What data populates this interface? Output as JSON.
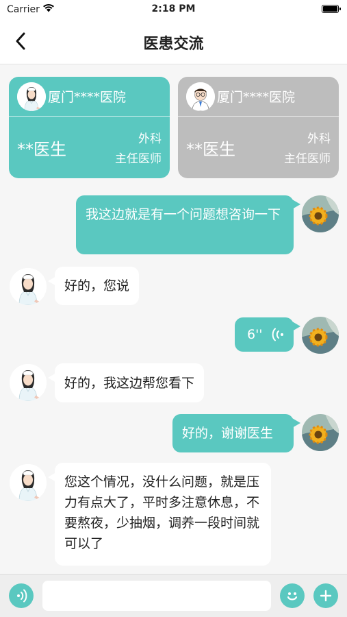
{
  "status_bar": {
    "carrier": "Carrier",
    "time": "2:18 PM"
  },
  "nav": {
    "title": "医患交流"
  },
  "doctor_cards": [
    {
      "hospital": "厦门****医院",
      "name": "**医生",
      "department": "外科",
      "rank": "主任医师"
    },
    {
      "hospital": "厦门****医院",
      "name": "**医生",
      "department": "外科",
      "rank": "主任医师"
    }
  ],
  "messages": [
    {
      "from": "me",
      "text": "我这边就是有一个问题想咨询一下"
    },
    {
      "from": "doctor",
      "text": "好的，您说"
    },
    {
      "from": "me",
      "type": "voice",
      "duration": "6''"
    },
    {
      "from": "doctor",
      "text": "好的，我这边帮您看下"
    },
    {
      "from": "me",
      "text": "好的，谢谢医生"
    },
    {
      "from": "doctor",
      "text": "您这个情况，没什么问题，就是压力有点大了，平时多注意休息，不要熬夜，少抽烟，调养一段时间就可以了"
    }
  ],
  "input_bar": {
    "value": "",
    "placeholder": ""
  },
  "colors": {
    "accent": "#5ac8c0",
    "inactive_card": "#bdbdbd"
  },
  "icons": [
    "wifi-icon",
    "battery-icon",
    "back-arrow-icon",
    "voice-toggle-icon",
    "emoji-icon",
    "plus-icon",
    "voice-wave-icon"
  ]
}
